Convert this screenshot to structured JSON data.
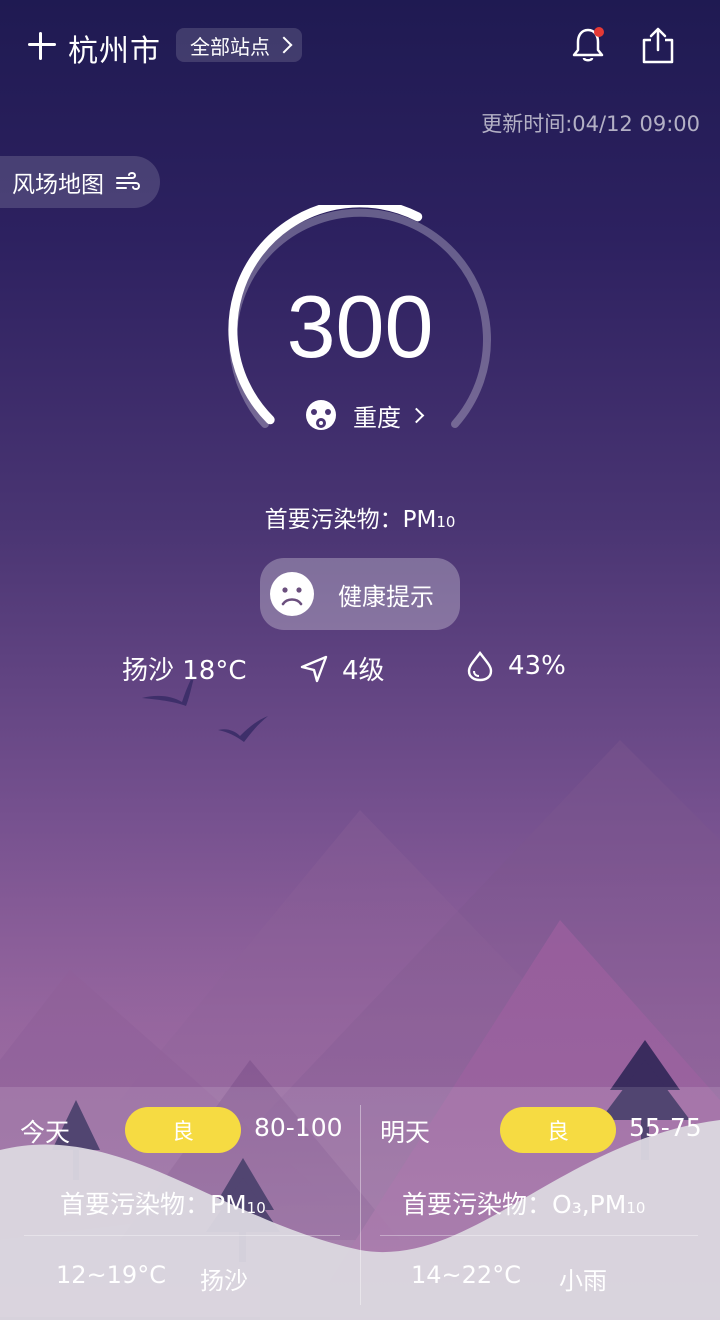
{
  "header": {
    "add_icon": "plus-icon",
    "city": "杭州市",
    "station_selector": "全部站点",
    "notification_icon": "bell-icon",
    "notification_dot_color": "#e53935",
    "share_icon": "share-icon"
  },
  "update_time": "更新时间:04/12 09:00",
  "wind_map": {
    "label": "风场地图",
    "icon": "wind-icon"
  },
  "aqi": {
    "value": "300",
    "level": "重度",
    "level_icon": "mask-icon",
    "gauge_fraction": 0.6
  },
  "primary_pollutant": {
    "label": "首要污染物：",
    "name": "PM",
    "subscript": "10"
  },
  "health_tip": {
    "label": "健康提示",
    "icon": "sad-face-icon"
  },
  "weather": {
    "condition_temp": "扬沙 18°C",
    "wind_icon": "navigation-arrow-icon",
    "wind": "4级",
    "humidity_icon": "water-drop-icon",
    "humidity": "43%"
  },
  "forecast": {
    "badge_color": "#f6db42",
    "today": {
      "day": "今天",
      "quality": "良",
      "range": "80-100",
      "pollutant_label": "首要污染物：",
      "pollutant": "PM",
      "pollutant_sub": "10",
      "temp": "12~19°C",
      "condition": "扬沙"
    },
    "tomorrow": {
      "day": "明天",
      "quality": "良",
      "range": "55-75",
      "pollutant_label": "首要污染物：",
      "pollutant": "O₃,PM",
      "pollutant_sub": "10",
      "temp": "14~22°C",
      "condition": "小雨"
    }
  }
}
